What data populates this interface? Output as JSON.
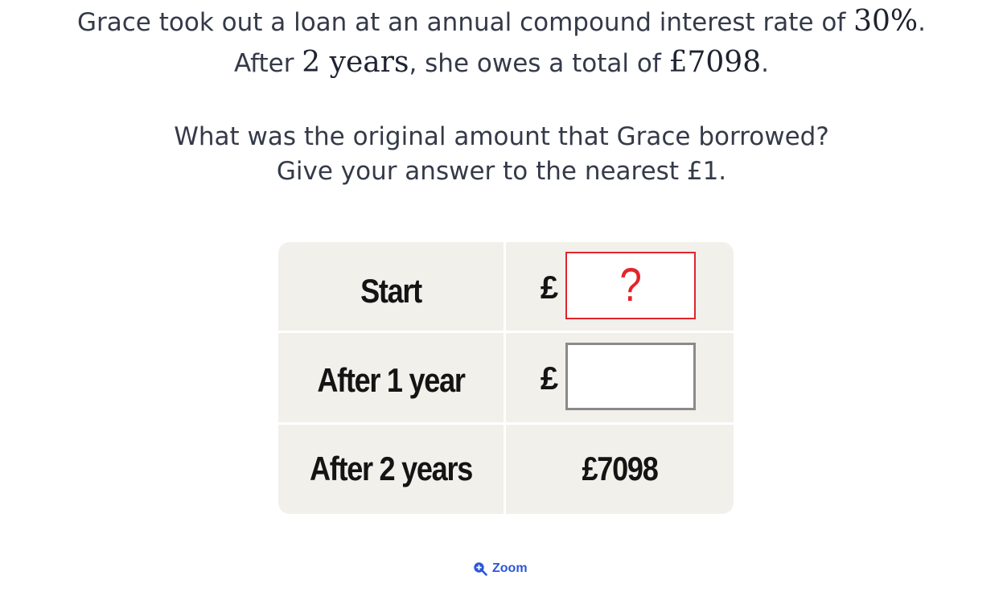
{
  "question": {
    "line1_text": "Grace took out a loan at an annual compound interest rate of ",
    "line1_math": "30%",
    "line1_end": ".",
    "line2_start": "After ",
    "line2_math_years": "2 years",
    "line2_mid": ", she owes a total of ",
    "line2_math_amount": "£7098",
    "line2_end": "."
  },
  "prompt": {
    "line1": "What was the original amount that Grace borrowed?",
    "line2": "Give your answer to the nearest £1."
  },
  "table": {
    "rows": [
      {
        "label": "Start",
        "currency": "£",
        "value": "?"
      },
      {
        "label": "After 1 year",
        "currency": "£",
        "value": ""
      },
      {
        "label": "After 2 years",
        "value": "£7098"
      }
    ]
  },
  "zoom": {
    "label": "Zoom",
    "icon": "zoom-in-icon"
  },
  "colors": {
    "accent": "#2c55d8",
    "highlight": "#e3242b",
    "table_bg": "#f2f0eb"
  }
}
